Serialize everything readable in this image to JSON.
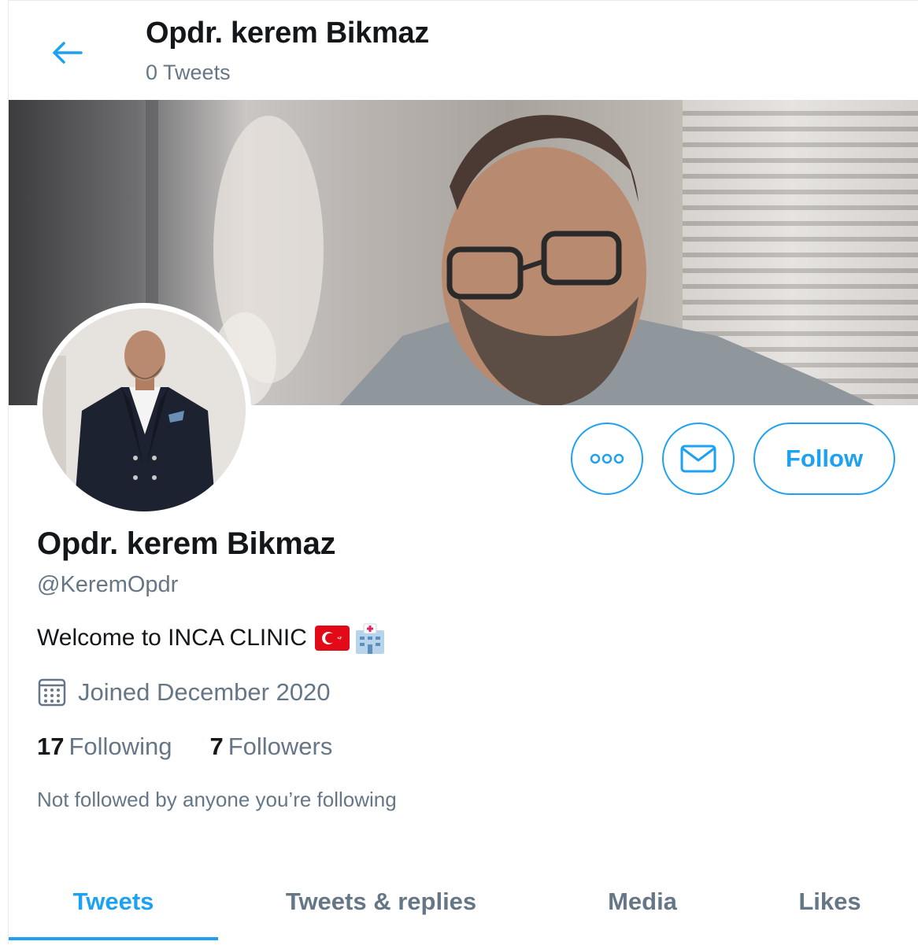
{
  "header": {
    "title": "Opdr. kerem Bikmaz",
    "tweet_count": "0 Tweets"
  },
  "profile": {
    "display_name": "Opdr. kerem Bikmaz",
    "handle": "@KeremOpdr",
    "bio": "Welcome to INCA CLINIC",
    "bio_emojis": [
      "turkey-flag-icon",
      "hospital-icon"
    ],
    "joined": "Joined December 2020",
    "following_count": "17",
    "following_label": "Following",
    "followers_count": "7",
    "followers_label": "Followers",
    "not_followed_note": "Not followed by anyone you’re following"
  },
  "actions": {
    "follow_label": "Follow"
  },
  "tabs": [
    {
      "label": "Tweets",
      "active": true
    },
    {
      "label": "Tweets & replies",
      "active": false
    },
    {
      "label": "Media",
      "active": false
    },
    {
      "label": "Likes",
      "active": false
    }
  ],
  "colors": {
    "accent": "#1da1f2",
    "muted_text": "#657786",
    "primary_text": "#14171a"
  }
}
